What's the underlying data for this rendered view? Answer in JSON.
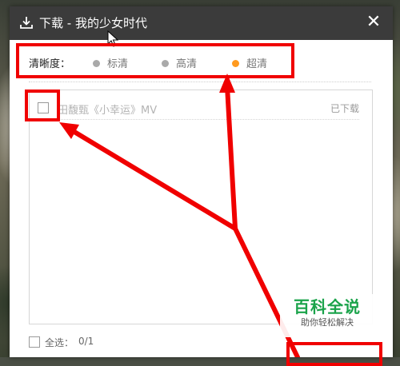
{
  "window": {
    "title": "下载 - 我的少女时代",
    "close_symbol": "✕",
    "download_icon": "download-icon"
  },
  "quality": {
    "label": "清晰度：",
    "options": [
      {
        "label": "标清",
        "selected": false
      },
      {
        "label": "高清",
        "selected": false
      },
      {
        "label": "超清",
        "selected": true
      }
    ],
    "active_color": "#ff9a1f",
    "inactive_color": "#a9a9a9"
  },
  "list": {
    "items": [
      {
        "title": "田馥甄《小幸运》MV",
        "status": "已下载",
        "checked": false
      }
    ]
  },
  "footer": {
    "select_all_label": "全选：",
    "selected_count": "0/1"
  },
  "annotation": {
    "color": "#f00000"
  },
  "watermark": {
    "title": "百科全说",
    "subtitle": "助你轻松解决"
  }
}
